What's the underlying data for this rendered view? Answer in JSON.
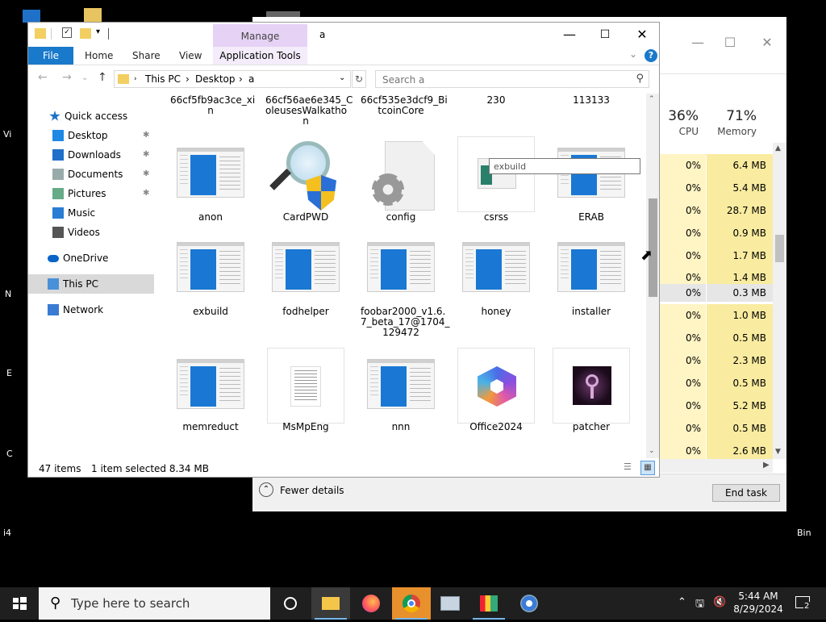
{
  "desktop": {
    "edge_labels": [
      "Vi",
      "N",
      "E",
      "C",
      "i4",
      "Bin"
    ]
  },
  "task_manager": {
    "cpu_pct": "36%",
    "cpu_label": "CPU",
    "mem_pct": "71%",
    "mem_label": "Memory",
    "rows": [
      {
        "cpu": "0%",
        "mem": "6.4 MB"
      },
      {
        "cpu": "0%",
        "mem": "5.4 MB"
      },
      {
        "cpu": "0%",
        "mem": "28.7 MB"
      },
      {
        "cpu": "0%",
        "mem": "0.9 MB"
      },
      {
        "cpu": "0%",
        "mem": "1.7 MB"
      },
      {
        "cpu": "0%",
        "mem": "1.4 MB"
      },
      {
        "cpu": "0%",
        "mem": "0.3 MB",
        "selected": true
      },
      {
        "cpu": "0%",
        "mem": "1.0 MB"
      },
      {
        "cpu": "0%",
        "mem": "0.5 MB"
      },
      {
        "cpu": "0%",
        "mem": "2.3 MB"
      },
      {
        "cpu": "0%",
        "mem": "0.5 MB"
      },
      {
        "cpu": "0%",
        "mem": "5.2 MB"
      },
      {
        "cpu": "0%",
        "mem": "0.5 MB"
      },
      {
        "cpu": "0%",
        "mem": "2.6 MB"
      }
    ],
    "fewer_details": "Fewer details",
    "end_task": "End task"
  },
  "explorer": {
    "title": "a",
    "manage_tab": "Manage",
    "ribbon": {
      "file": "File",
      "home": "Home",
      "share": "Share",
      "view": "View",
      "app_tools": "Application Tools"
    },
    "address": [
      "This PC",
      "Desktop",
      "a"
    ],
    "search_placeholder": "Search a",
    "nav": [
      {
        "label": "Quick access",
        "icon": "star-icon"
      },
      {
        "label": "Desktop",
        "icon": "desktop-folder-icon",
        "pinned": true
      },
      {
        "label": "Downloads",
        "icon": "downloads-icon",
        "pinned": true
      },
      {
        "label": "Documents",
        "icon": "documents-icon",
        "pinned": true
      },
      {
        "label": "Pictures",
        "icon": "pictures-icon",
        "pinned": true
      },
      {
        "label": "Music",
        "icon": "music-icon"
      },
      {
        "label": "Videos",
        "icon": "videos-icon"
      },
      {
        "label": "OneDrive",
        "icon": "onedrive-icon"
      },
      {
        "label": "This PC",
        "icon": "this-pc-icon",
        "selected": true
      },
      {
        "label": "Network",
        "icon": "network-icon"
      }
    ],
    "top_partial_names": [
      [
        "66cf5fb9ac3ce_xi",
        "n"
      ],
      [
        "66cf56ae6e345_C",
        "oleusesWalkatho",
        "n"
      ],
      [
        "66cf535e3dcf9_Bi",
        "tcoinCore"
      ],
      [
        "230"
      ],
      [
        "113133"
      ]
    ],
    "row1": [
      {
        "name": [
          "anon"
        ],
        "thumb": "window"
      },
      {
        "name": [
          "CardPWD"
        ],
        "thumb": "magnifier-shield"
      },
      {
        "name": [
          "config"
        ],
        "thumb": "config-gear"
      },
      {
        "name": [
          "csrss"
        ],
        "thumb": "small-window",
        "framed": true
      },
      {
        "name": [
          "ERAB"
        ],
        "thumb": "window"
      }
    ],
    "row2": [
      {
        "name": [
          "exbuild"
        ],
        "thumb": "window"
      },
      {
        "name": [
          "fodhelper"
        ],
        "thumb": "window"
      },
      {
        "name": [
          "foobar2000_v1.6.",
          "7_beta_17@1704_",
          "129472"
        ],
        "thumb": "window"
      },
      {
        "name": [
          "honey"
        ],
        "thumb": "window"
      },
      {
        "name": [
          "installer"
        ],
        "thumb": "window"
      }
    ],
    "row3": [
      {
        "name": [
          "memreduct"
        ],
        "thumb": "window"
      },
      {
        "name": [
          "MsMpEng"
        ],
        "thumb": "document",
        "framed": true
      },
      {
        "name": [
          "nnn"
        ],
        "thumb": "window"
      },
      {
        "name": [
          "Office2024"
        ],
        "thumb": "office-logo",
        "framed": true
      },
      {
        "name": [
          "patcher"
        ],
        "thumb": "patcher-logo",
        "framed": true
      }
    ],
    "tooltip": "exbuild",
    "status_count": "47 items",
    "status_selected": "1 item selected  8.34 MB"
  },
  "taskbar": {
    "search_placeholder": "Type here to search",
    "time": "5:44 AM",
    "date": "8/29/2024",
    "notification_count": "2"
  }
}
